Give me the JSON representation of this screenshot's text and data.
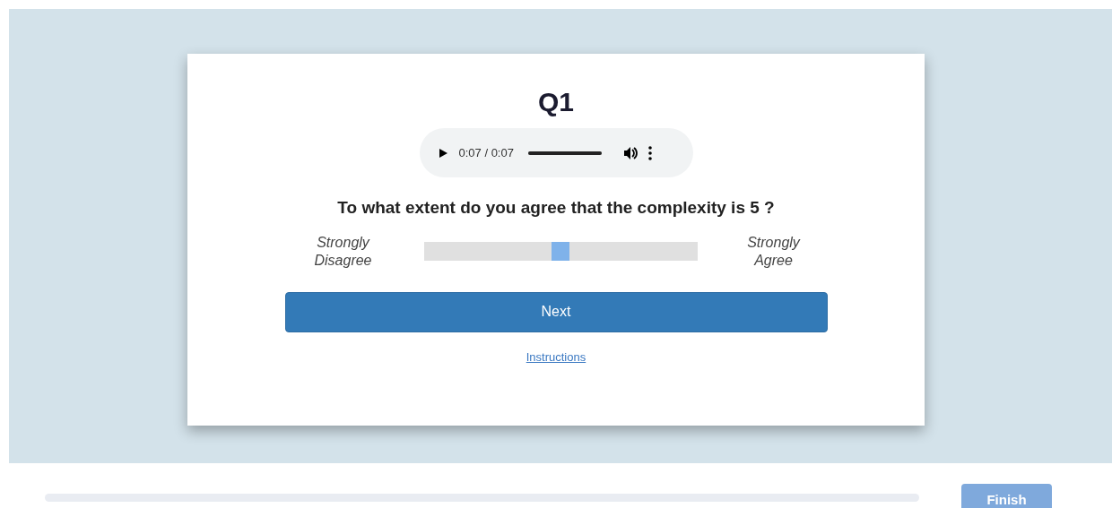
{
  "card": {
    "title": "Q1",
    "audio": {
      "time": "0:07 / 0:07",
      "level": 1
    },
    "question": "To what extent do you agree that the complexity is 5 ?",
    "scale": {
      "left_label": "Strongly Disagree",
      "right_label": "Strongly Agree",
      "level": 0.5
    },
    "next_button": "Next",
    "instructions_link": "Instructions"
  },
  "footer": {
    "finish_button": {
      "label": "Finish",
      "disabled": true
    }
  }
}
